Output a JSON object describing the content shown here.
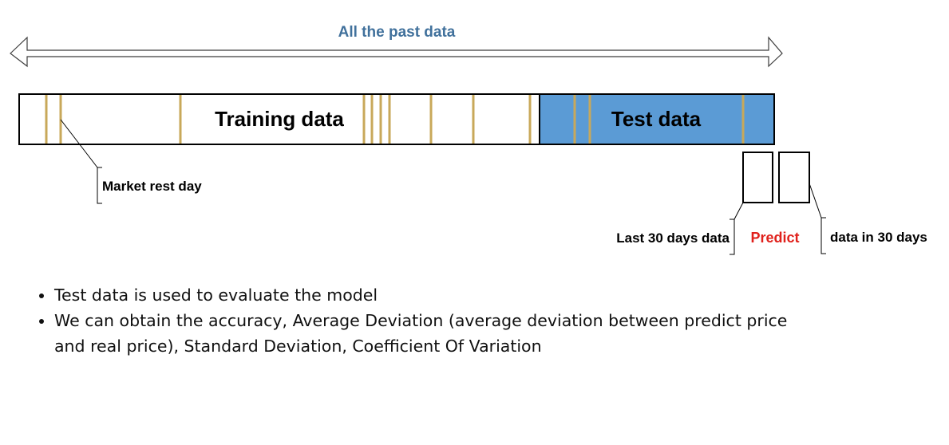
{
  "diagram": {
    "title": "All the past data",
    "training_label": "Training data",
    "test_label": "Test data",
    "market_rest_label": "Market rest day",
    "last30_label": "Last 30 days data",
    "predict_label": "Predict",
    "next30_label": "data in 30 days",
    "colors": {
      "title": "#41719c",
      "test_fill": "#5b9bd5",
      "rest_day_line": "#c8a85a",
      "predict": "#e0201b"
    }
  },
  "bullets": [
    "Test data is used to evaluate the model",
    "We can obtain the accuracy, Average Deviation (average deviation between predict price and real price), Standard Deviation, Coefficient Of Variation"
  ]
}
